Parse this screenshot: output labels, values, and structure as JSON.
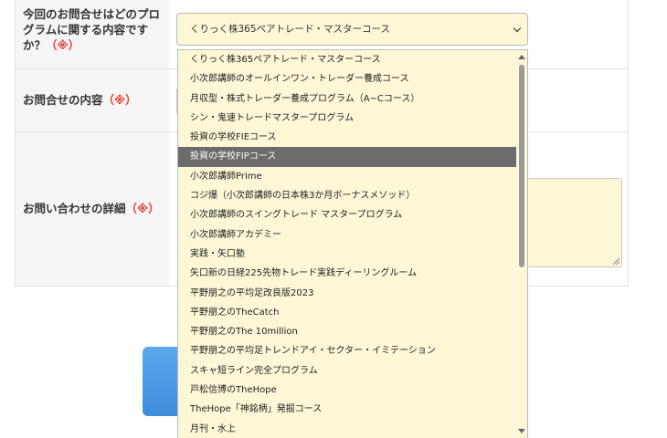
{
  "form": {
    "rows": [
      {
        "label": "今回のお問合せはどのプログラムに関する内容ですか？",
        "required": "（※）"
      },
      {
        "label": "お問合せの内容",
        "required": "（※）"
      },
      {
        "label": "お問い合わせの詳細",
        "required": "（※）"
      }
    ],
    "program_select": {
      "value": "くりっく株365ペアトレード・マスターコース",
      "icon": "chevron-down-icon"
    }
  },
  "dropdown": {
    "highlighted_index": 5,
    "options": [
      "くりっく株365ペアトレード・マスターコース",
      "小次郎講師のオールインワン・トレーダー養成コース",
      "月収型・株式トレーダー養成プログラム（A~Cコース）",
      "シン・鬼速トレードマスタープログラム",
      "投資の学校FIEコース",
      "投資の学校FIPコース",
      "小次郎講師Prime",
      "コジ爆（小次郎講師の日本株3か月ボーナスメソッド）",
      "小次郎講師のスイングトレード マスタープログラム",
      "小次郎講師アカデミー",
      "実践・矢口塾",
      "矢口新の日経225先物トレード実践ディーリングルーム",
      "平野朋之の平均足改良版2023",
      "平野朋之のTheCatch",
      "平野朋之のThe 10million",
      "平野朋之の平均足トレンドアイ・セクター・イミテーション",
      "スキャ短ライン完全プログラム",
      "戸松信博のTheHope",
      "TheHope「神銘柄」発掘コース",
      "月刊・水上"
    ]
  },
  "colors": {
    "required": "#e8382f",
    "field_bg": "#fdf7d6",
    "highlight": "#6c6c6c",
    "submit": "#4a9be4"
  }
}
